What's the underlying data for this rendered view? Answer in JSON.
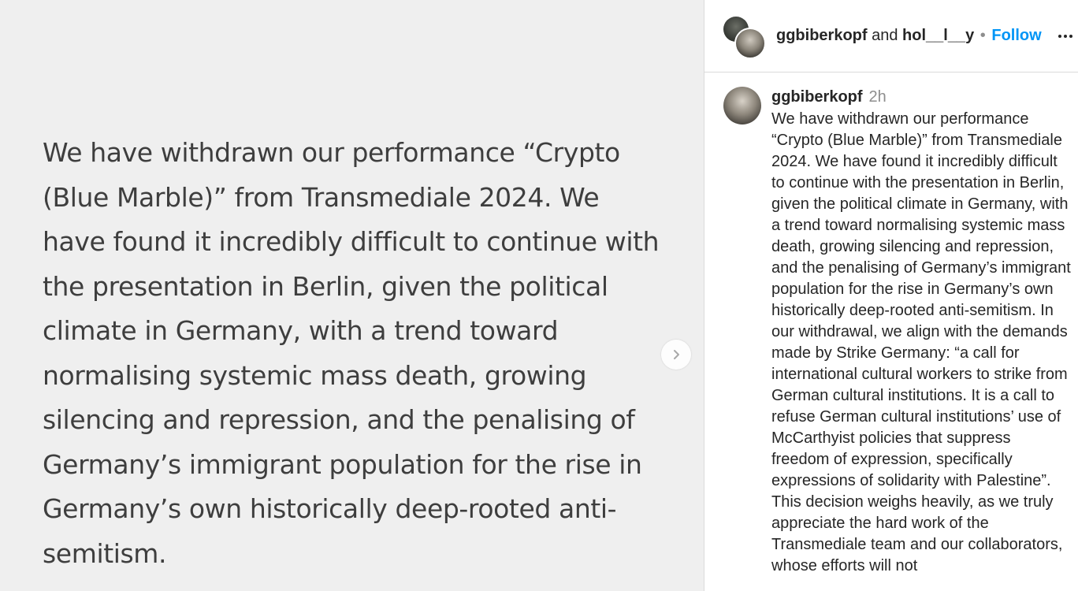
{
  "media": {
    "text": "We have withdrawn our performance “Crypto (Blue Marble)” from Transmediale 2024. We have found it incredibly difficult to continue with the presentation in Berlin, given the political climate in Germany, with a trend toward normalising systemic mass death, growing silencing and repression, and the penalising of Germany’s immigrant population for the rise in Germany’s own historically deep-rooted anti-semitism.",
    "next_icon": "chevron-right-icon"
  },
  "header": {
    "user1": "ggbiberkopf",
    "and_text": "and",
    "user2": "hol__l__y",
    "separator": "•",
    "follow_label": "Follow",
    "more_icon": "more-horizontal-icon"
  },
  "comment": {
    "username": "ggbiberkopf",
    "time": "2h",
    "body": "We have withdrawn our performance “Crypto (Blue Marble)” from Transmediale 2024. We have found it incredibly difficult to continue with the presentation in Berlin, given the political climate in Germany, with a trend toward normalising systemic mass death, growing silencing and repression, and the penalising of Germany’s immigrant population for the rise in Germany’s own historically deep-rooted anti-semitism. In our withdrawal, we align with the demands made by Strike Germany: “a call for international cultural workers to strike from German cultural institutions. It is a call to refuse German cultural institutions’ use of McCarthyist policies that suppress freedom of expression, specifically expressions of solidarity with Palestine”. This decision weighs heavily, as we truly appreciate the hard work of the Transmediale team and our collaborators, whose efforts will not"
  }
}
